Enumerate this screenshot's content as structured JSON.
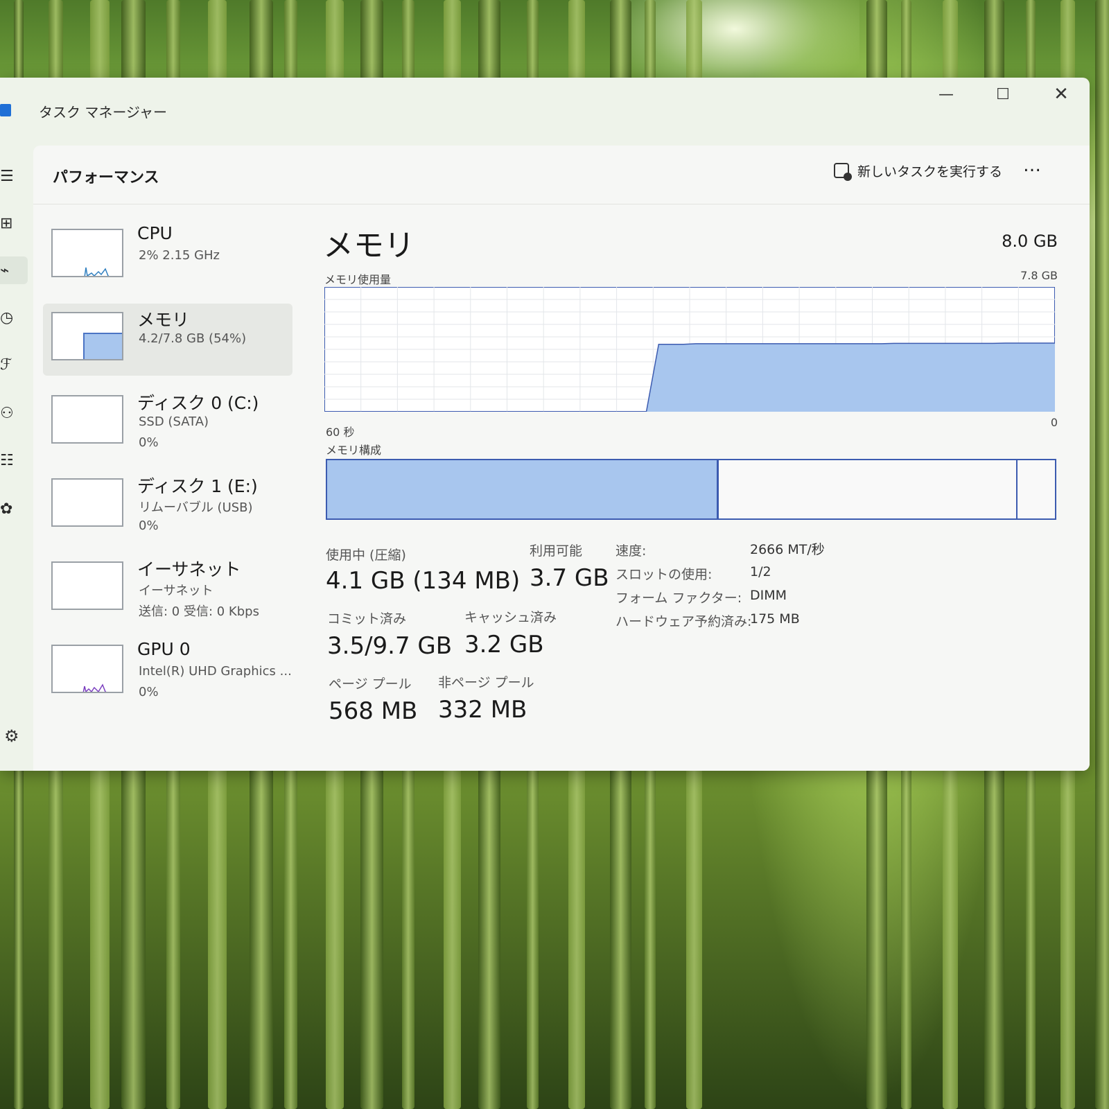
{
  "window": {
    "title": "タスク マネージャー",
    "controls": {
      "minimize": "—",
      "maximize": "☐",
      "close": "✕"
    }
  },
  "rail": {
    "items": [
      {
        "icon": "hamburger-menu-icon",
        "glyph": "☰"
      },
      {
        "icon": "processes-icon",
        "glyph": "⊞"
      },
      {
        "icon": "performance-icon",
        "glyph": "⌁"
      },
      {
        "icon": "app-history-icon",
        "glyph": "◷"
      },
      {
        "icon": "startup-apps-icon",
        "glyph": "ℱ"
      },
      {
        "icon": "users-icon",
        "glyph": "⚇"
      },
      {
        "icon": "details-icon",
        "glyph": "☷"
      },
      {
        "icon": "services-icon",
        "glyph": "✿"
      }
    ],
    "settings": {
      "icon": "settings-gear-icon",
      "glyph": "⚙"
    }
  },
  "header": {
    "title": "パフォーマンス",
    "run_task": "新しいタスクを実行する",
    "more": "…"
  },
  "devices": [
    {
      "name": "CPU",
      "sub": "2%  2.15 GHz",
      "sub2": ""
    },
    {
      "name": "メモリ",
      "sub": "4.2/7.8 GB (54%)",
      "sub2": ""
    },
    {
      "name": "ディスク 0 (C:)",
      "sub": "SSD (SATA)",
      "sub2": "0%"
    },
    {
      "name": "ディスク 1 (E:)",
      "sub": "リムーバブル (USB)",
      "sub2": "0%"
    },
    {
      "name": "イーサネット",
      "sub": "イーサネット",
      "sub2": "送信: 0  受信: 0 Kbps"
    },
    {
      "name": "GPU 0",
      "sub": "Intel(R) UHD Graphics ...",
      "sub2": "0%"
    }
  ],
  "memory": {
    "title": "メモリ",
    "total": "8.0 GB",
    "usage_label": "メモリ使用量",
    "usage_max": "7.8 GB",
    "axis_left": "60 秒",
    "axis_right": "0",
    "composition_label": "メモリ構成",
    "composition": {
      "in_use_fraction": 0.535,
      "standby_end_fraction": 0.947
    },
    "usage_series": [
      0,
      0,
      0,
      0,
      0,
      0,
      0,
      0,
      0,
      0,
      0,
      0,
      0,
      0,
      0,
      0,
      0,
      0,
      0,
      0,
      0,
      0,
      0,
      0,
      0,
      0,
      0,
      0.54,
      0.54,
      0.54,
      0.545,
      0.545,
      0.545,
      0.545,
      0.545,
      0.545,
      0.545,
      0.545,
      0.545,
      0.545,
      0.545,
      0.545,
      0.545,
      0.545,
      0.545,
      0.545,
      0.548,
      0.548,
      0.548,
      0.548,
      0.548,
      0.548,
      0.548,
      0.548,
      0.548,
      0.55,
      0.55,
      0.55,
      0.55,
      0.55
    ],
    "stats": {
      "in_use_label": "使用中 (圧縮)",
      "in_use": "4.1 GB (134 MB)",
      "available_label": "利用可能",
      "available": "3.7 GB",
      "committed_label": "コミット済み",
      "committed": "3.5/9.7 GB",
      "cached_label": "キャッシュ済み",
      "cached": "3.2 GB",
      "paged_label": "ページ プール",
      "paged": "568 MB",
      "nonpaged_label": "非ページ プール",
      "nonpaged": "332 MB"
    },
    "details": {
      "speed_label": "速度:",
      "speed": "2666 MT/秒",
      "slots_label": "スロットの使用:",
      "slots": "1/2",
      "form_label": "フォーム ファクター:",
      "form": "DIMM",
      "reserved_label": "ハードウェア予約済み:",
      "reserved": "175 MB"
    }
  }
}
